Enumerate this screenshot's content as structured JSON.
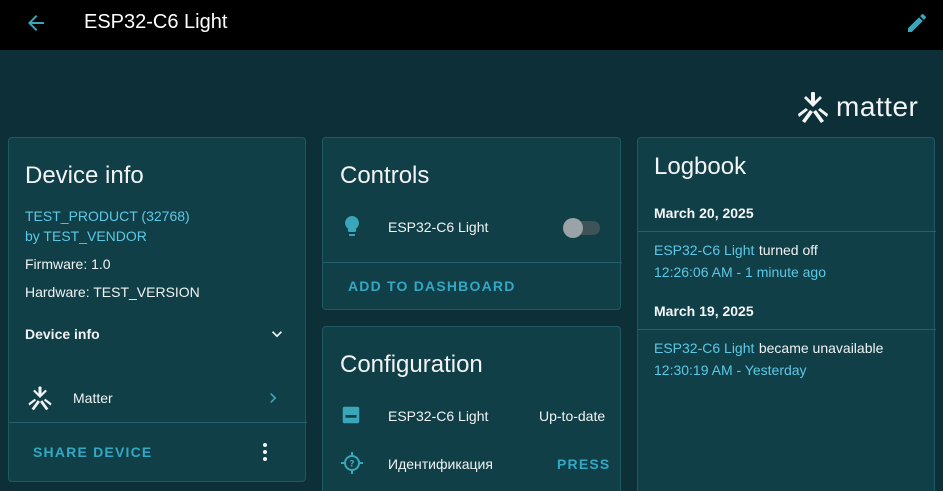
{
  "header": {
    "title": "ESP32-C6 Light"
  },
  "brand": {
    "text": "matter"
  },
  "device_info": {
    "title": "Device info",
    "product_link": "TEST_PRODUCT (32768)",
    "vendor_link": "by TEST_VENDOR",
    "firmware": "Firmware: 1.0",
    "hardware": "Hardware: TEST_VERSION",
    "section_label": "Device info",
    "integration_label": "Matter",
    "share_button": "SHARE DEVICE"
  },
  "controls": {
    "title": "Controls",
    "entity_name": "ESP32-C6 Light",
    "toggle_on": false,
    "add_button": "ADD TO DASHBOARD"
  },
  "configuration": {
    "title": "Configuration",
    "rows": [
      {
        "name": "ESP32-C6 Light",
        "value": "Up-to-date"
      },
      {
        "name": "Идентификация",
        "action": "PRESS"
      }
    ]
  },
  "logbook": {
    "title": "Logbook",
    "groups": [
      {
        "date": "March 20, 2025",
        "entity": "ESP32-C6 Light",
        "event": "turned off",
        "time": "12:26:06 AM - 1 minute ago"
      },
      {
        "date": "March 19, 2025",
        "entity": "ESP32-C6 Light",
        "event": "became unavailable",
        "time": "12:30:19 AM - Yesterday"
      }
    ]
  },
  "colors": {
    "background": "#0d3038",
    "card": "#113f47",
    "accent": "#32a8c4",
    "link": "#5cc8e6"
  }
}
